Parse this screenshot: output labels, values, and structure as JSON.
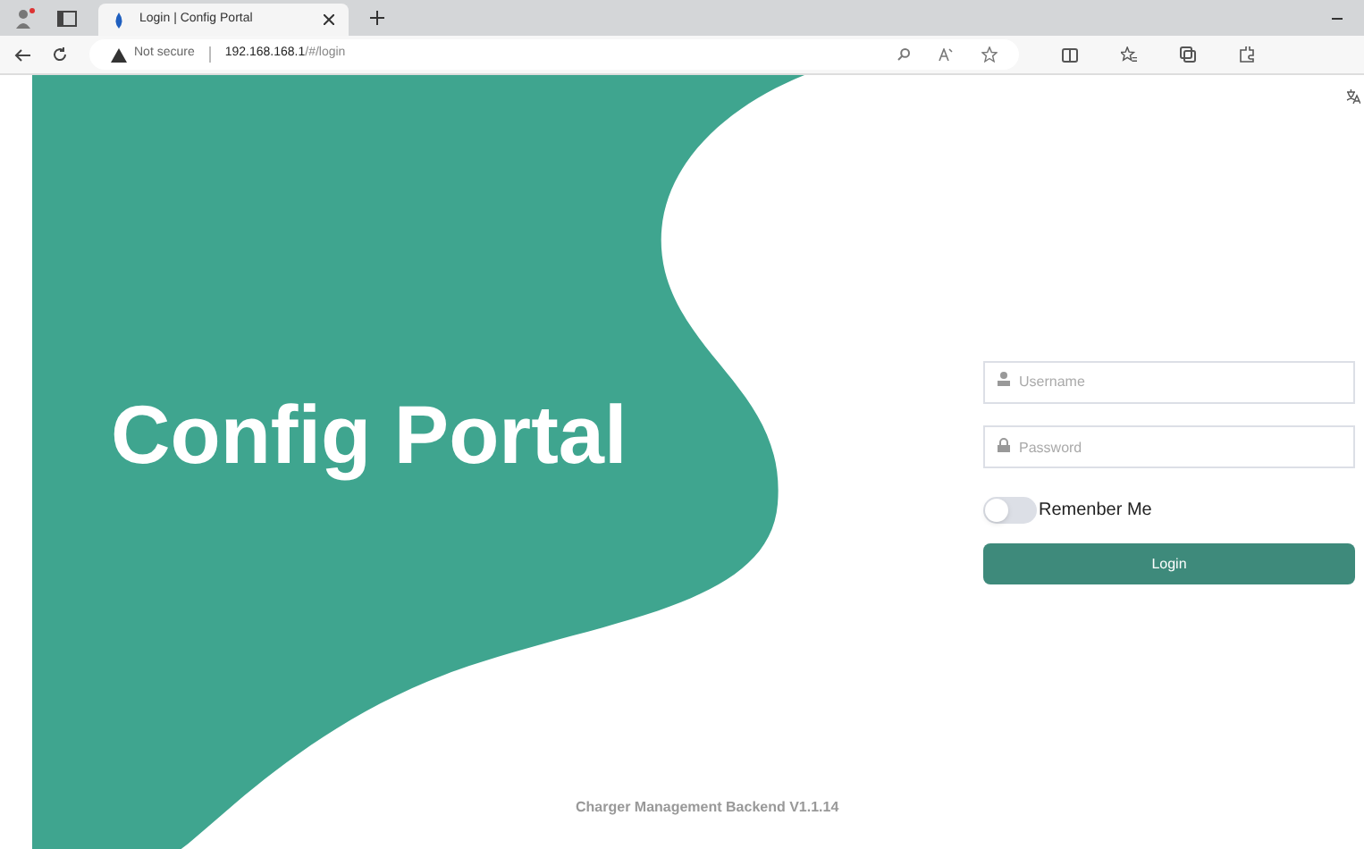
{
  "browser": {
    "tab_title": "Login | Config Portal",
    "address_prefix": "Not secure",
    "address": "192.168.168.1",
    "address_path": "/#/login"
  },
  "page": {
    "title": "Config Portal",
    "username": {
      "placeholder": "Username"
    },
    "password": {
      "placeholder": "Password"
    },
    "remember_me": {
      "label": "Remenber Me",
      "on": false
    },
    "login_button": "Login",
    "footer": "Charger Management Backend V1.1.14"
  }
}
